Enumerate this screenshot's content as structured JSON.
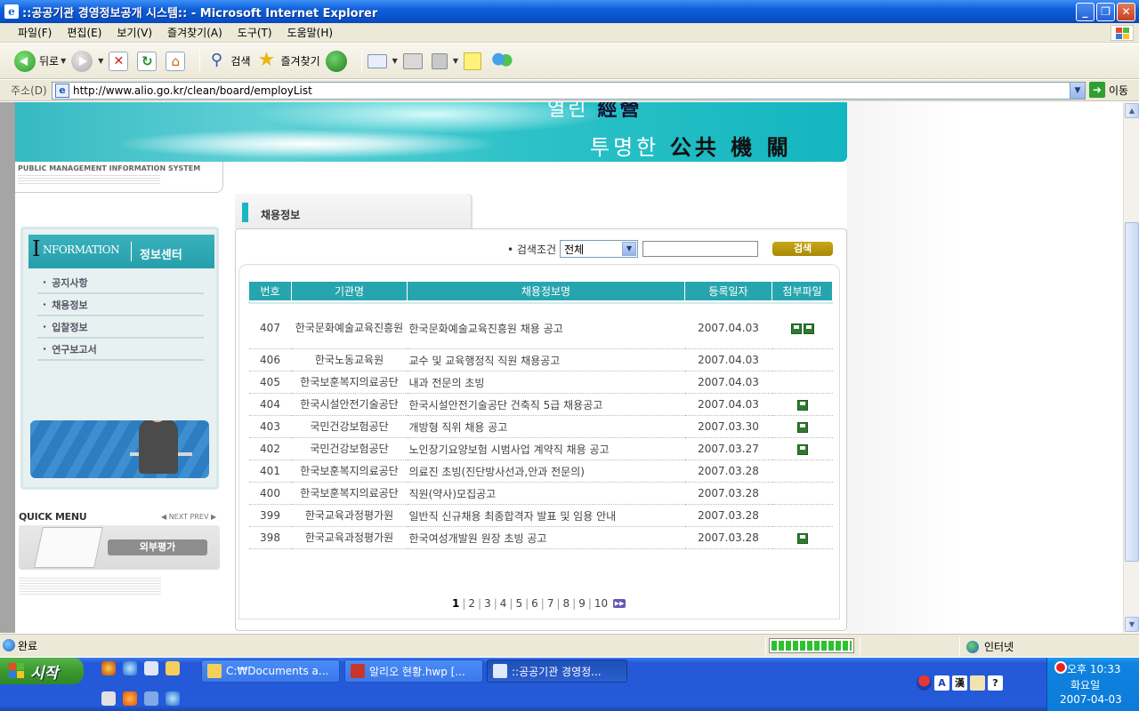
{
  "window": {
    "title": "::공공기관 경영정보공개 시스템:: - Microsoft Internet Explorer",
    "buttons": {
      "minimize": "_",
      "maximize": "❐",
      "close": "✕"
    }
  },
  "menubar": {
    "items": [
      "파일(F)",
      "편집(E)",
      "보기(V)",
      "즐겨찾기(A)",
      "도구(T)",
      "도움말(H)"
    ]
  },
  "toolbar": {
    "back_label": "뒤로",
    "search_label": "검색",
    "favorites_label": "즐겨찾기"
  },
  "addressbar": {
    "label": "주소(D)",
    "url": "http://www.alio.go.kr/clean/board/employList",
    "go_label": "이동"
  },
  "banner": {
    "slogan_top_kor": "열린 ",
    "slogan_top_han": "經營",
    "slogan_bottom_kor": "투명한 ",
    "slogan_bottom_han": "公共 機 關",
    "system_name": "PUBLIC MANAGEMENT INFORMATION SYSTEM"
  },
  "sidebar": {
    "header_en_initial": "I",
    "header_en_rest": "NFORMATION",
    "header_ko": "정보센터",
    "items": [
      {
        "label": "공지사항"
      },
      {
        "label": "채용정보"
      },
      {
        "label": "입찰정보"
      },
      {
        "label": "연구보고서"
      }
    ]
  },
  "quickmenu": {
    "title": "QUICK MENU",
    "nav_next": "◀ NEXT",
    "nav_prev": "PREV ▶",
    "button_label": "외부평가"
  },
  "main": {
    "section_title": "채용정보",
    "search": {
      "label": "• 검색조건",
      "select_value": "전체",
      "input_value": "",
      "button_label": "검색"
    },
    "table": {
      "headers": [
        "번호",
        "기관명",
        "채용정보명",
        "등록일자",
        "첨부파일"
      ],
      "rows": [
        {
          "num": "407",
          "org": "한국문화예술교육진흥원",
          "title": "한국문화예술교육진흥원 채용 공고",
          "date": "2007.04.03",
          "files": 2
        },
        {
          "num": "406",
          "org": "한국노동교육원",
          "title": "교수 및 교육행정직 직원 채용공고",
          "date": "2007.04.03",
          "files": 0
        },
        {
          "num": "405",
          "org": "한국보훈복지의료공단",
          "title": "내과 전문의 초빙",
          "date": "2007.04.03",
          "files": 0
        },
        {
          "num": "404",
          "org": "한국시설안전기술공단",
          "title": "한국시설안전기술공단 건축직 5급 채용공고",
          "date": "2007.04.03",
          "files": 1
        },
        {
          "num": "403",
          "org": "국민건강보험공단",
          "title": "개방형 직위 채용 공고",
          "date": "2007.03.30",
          "files": 1
        },
        {
          "num": "402",
          "org": "국민건강보험공단",
          "title": "노인장기요양보험 시범사업 계약직 채용 공고",
          "date": "2007.03.27",
          "files": 1
        },
        {
          "num": "401",
          "org": "한국보훈복지의료공단",
          "title": "의료진 초빙(진단방사선과,안과 전문의)",
          "date": "2007.03.28",
          "files": 0
        },
        {
          "num": "400",
          "org": "한국보훈복지의료공단",
          "title": "직원(약사)모집공고",
          "date": "2007.03.28",
          "files": 0
        },
        {
          "num": "399",
          "org": "한국교육과정평가원",
          "title": "일반직 신규채용 최종합격자 발표 및 임용 안내",
          "date": "2007.03.28",
          "files": 0
        },
        {
          "num": "398",
          "org": "한국교육과정평가원",
          "title": "한국여성개발원 원장 초빙 공고",
          "date": "2007.03.28",
          "files": 1
        }
      ]
    },
    "pagination": {
      "current": "1",
      "pages": [
        "1",
        "2",
        "3",
        "4",
        "5",
        "6",
        "7",
        "8",
        "9",
        "10"
      ]
    }
  },
  "statusbar": {
    "status_text": "완료",
    "progress": 1.0,
    "zone": "인터넷"
  },
  "taskbar": {
    "start_label": "시작",
    "windows": [
      {
        "label": "C:₩Documents a...",
        "active": false
      },
      {
        "label": "알리오 현황.hwp [...",
        "active": false
      },
      {
        "label": "::공공기관 경영정...",
        "active": true
      }
    ],
    "ime_han": "漢",
    "ime_a": "A",
    "clock": "오후 10:33",
    "weekday": "화요일",
    "date": "2007-04-03"
  },
  "colors": {
    "accent_teal": "#27a5ae",
    "search_button": "#b89a10",
    "title_bar": "#0f5fdc"
  }
}
